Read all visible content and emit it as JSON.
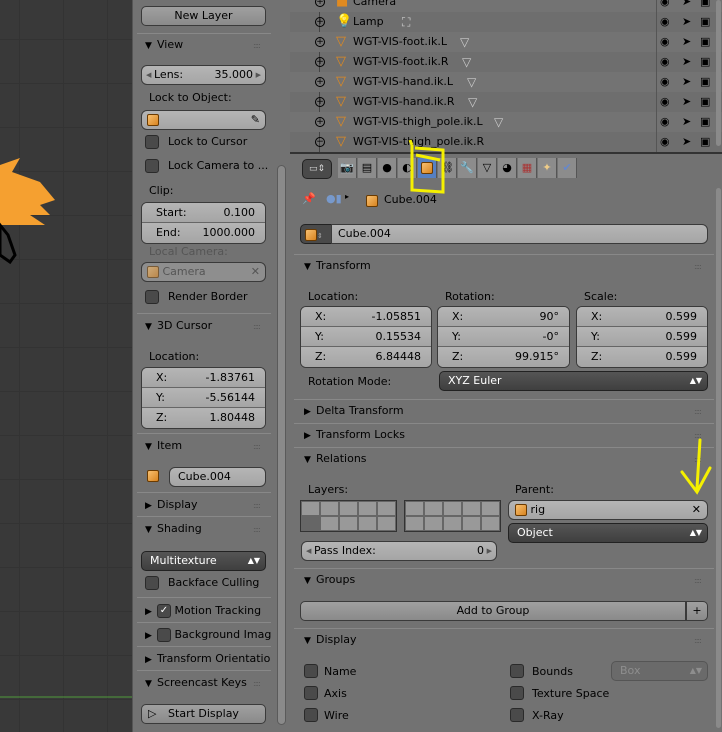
{
  "npanel": {
    "new_layer": "New Layer",
    "view": {
      "title": "View",
      "lens_label": "Lens:",
      "lens": "35.000",
      "lock_to_object": "Lock to Object:",
      "lock_to_cursor": "Lock to Cursor",
      "lock_camera": "Lock Camera to ...",
      "clip": "Clip:",
      "start_label": "Start:",
      "start": "0.100",
      "end_label": "End:",
      "end": "1000.000",
      "local_camera": "Local Camera:",
      "camera": "Camera",
      "render_border": "Render Border"
    },
    "cursor": {
      "title": "3D Cursor",
      "location": "Location:",
      "x_label": "X:",
      "x": "-1.83761",
      "y_label": "Y:",
      "y": "-5.56144",
      "z_label": "Z:",
      "z": "1.80448"
    },
    "item": {
      "title": "Item",
      "name": "Cube.004"
    },
    "display": {
      "title": "Display"
    },
    "shading": {
      "title": "Shading",
      "mode": "Multitexture",
      "backface": "Backface Culling"
    },
    "motion_tracking": "Motion Tracking",
    "background_images": "Background Imag",
    "transform_orientations": "Transform Orientatio",
    "screencast": {
      "title": "Screencast Keys",
      "start": "Start Display"
    }
  },
  "outliner": {
    "rows": [
      {
        "name": "Camera",
        "icon": "camera"
      },
      {
        "name": "Lamp",
        "icon": "lamp"
      },
      {
        "name": "WGT-VIS-foot.ik.L",
        "icon": "mesh"
      },
      {
        "name": "WGT-VIS-foot.ik.R",
        "icon": "mesh"
      },
      {
        "name": "WGT-VIS-hand.ik.L",
        "icon": "mesh"
      },
      {
        "name": "WGT-VIS-hand.ik.R",
        "icon": "mesh"
      },
      {
        "name": "WGT-VIS-thigh_pole.ik.L",
        "icon": "mesh"
      },
      {
        "name": "WGT-VIS-thigh_pole.ik.R",
        "icon": "mesh"
      }
    ]
  },
  "properties": {
    "breadcrumb": "Cube.004",
    "object_name": "Cube.004",
    "transform": {
      "title": "Transform",
      "location": "Location:",
      "rotation": "Rotation:",
      "scale": "Scale:",
      "loc": [
        [
          "X:",
          "-1.05851"
        ],
        [
          "Y:",
          "0.15534"
        ],
        [
          "Z:",
          "6.84448"
        ]
      ],
      "rot": [
        [
          "X:",
          "90°"
        ],
        [
          "Y:",
          "-0°"
        ],
        [
          "Z:",
          "99.915°"
        ]
      ],
      "scl": [
        [
          "X:",
          "0.599"
        ],
        [
          "Y:",
          "0.599"
        ],
        [
          "Z:",
          "0.599"
        ]
      ],
      "rotation_mode_label": "Rotation Mode:",
      "rotation_mode": "XYZ Euler"
    },
    "delta_transform": "Delta Transform",
    "transform_locks": "Transform Locks",
    "relations": {
      "title": "Relations",
      "layers": "Layers:",
      "parent": "Parent:",
      "parent_value": "rig",
      "parent_type": "Object",
      "pass_index_label": "Pass Index:",
      "pass_index": "0"
    },
    "groups": {
      "title": "Groups",
      "add": "Add to Group"
    },
    "display": {
      "title": "Display",
      "name": "Name",
      "axis": "Axis",
      "wire": "Wire",
      "bounds": "Bounds",
      "bounds_type": "Box",
      "texture_space": "Texture Space",
      "xray": "X-Ray"
    }
  },
  "annotation_color": "#f5f000"
}
